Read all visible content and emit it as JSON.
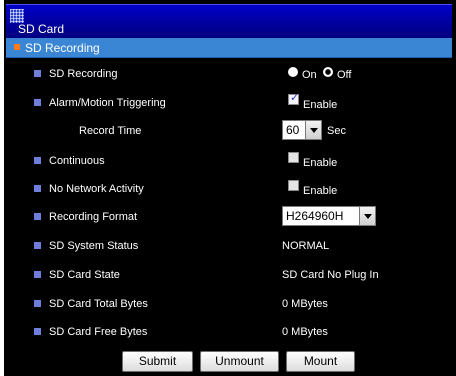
{
  "header": {
    "title": "SD Card"
  },
  "section": {
    "title": "SD Recording"
  },
  "rows": [
    {
      "label": "SD Recording",
      "control": "radio",
      "options": [
        {
          "label": "On",
          "selected": false
        },
        {
          "label": "Off",
          "selected": true
        }
      ]
    },
    {
      "label": "Alarm/Motion Triggering",
      "control": "checkbox",
      "checked": true,
      "checkbox_label": "Enable"
    },
    {
      "label": "Record Time",
      "control": "select",
      "selected": "60",
      "suffix": "Sec"
    },
    {
      "label": "Continuous",
      "control": "checkbox",
      "checked": false,
      "checkbox_label": "Enable"
    },
    {
      "label": "No Network Activity",
      "control": "checkbox",
      "checked": false,
      "checkbox_label": "Enable"
    },
    {
      "label": "Recording Format",
      "control": "select",
      "selected": "H264960H"
    },
    {
      "label": "SD System Status",
      "control": "text",
      "value": "NORMAL"
    },
    {
      "label": "SD Card State",
      "control": "text",
      "value": "SD Card No Plug In"
    },
    {
      "label": "SD Card Total Bytes",
      "control": "text",
      "value": "0 MBytes"
    },
    {
      "label": "SD Card Free Bytes",
      "control": "text",
      "value": "0 MBytes"
    }
  ],
  "buttons": {
    "submit": "Submit",
    "unmount": "Unmount",
    "mount": "Mount"
  },
  "colors": {
    "panel_bg": "#000000",
    "title_bar": "#00009c",
    "section_header": "#3a86d4",
    "section_bullet": "#ff7a1a",
    "row_bullet": "#6f7fd9",
    "text": "#ffffff"
  }
}
